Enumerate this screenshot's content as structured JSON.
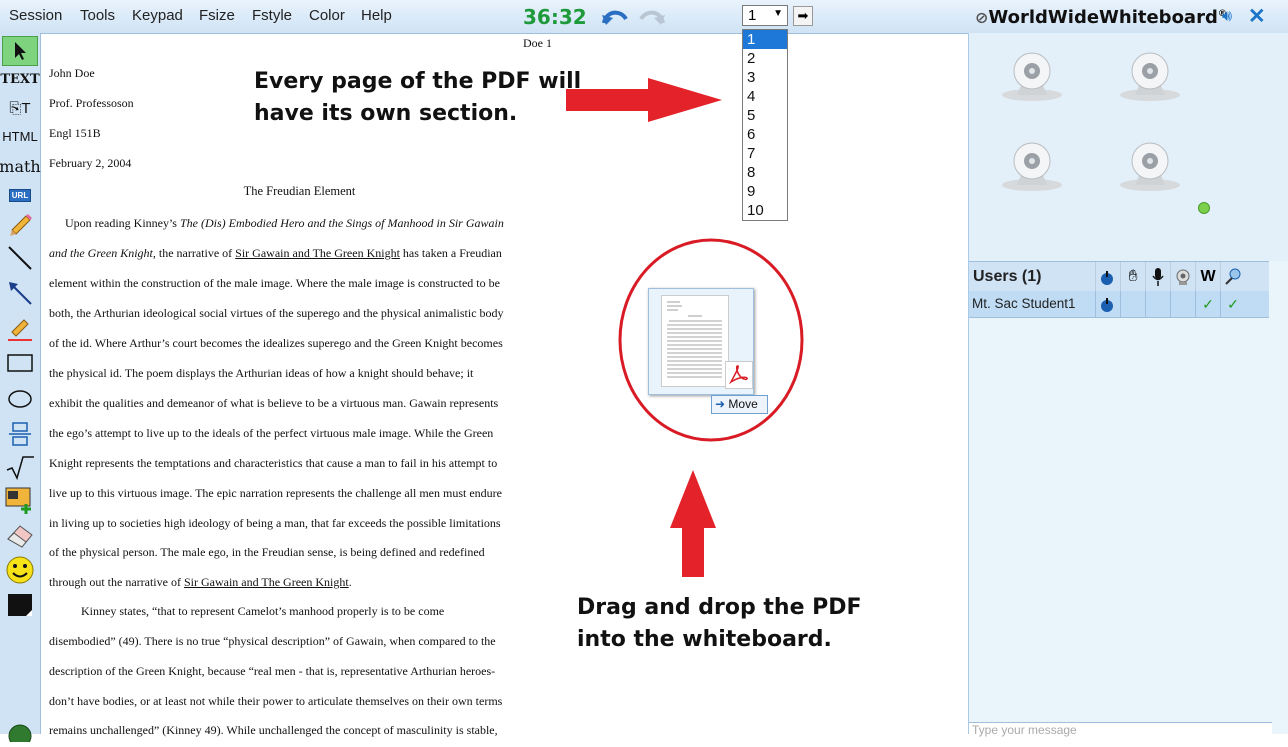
{
  "menubar": {
    "items": [
      "Session",
      "Tools",
      "Keypad",
      "Fsize",
      "Fstyle",
      "Color",
      "Help"
    ],
    "timer": "36:32",
    "page_select_value": "1",
    "brand": "WorldWideWhiteboard",
    "brand_mark": "®"
  },
  "page_list": [
    "1",
    "2",
    "3",
    "4",
    "5",
    "6",
    "7",
    "8",
    "9",
    "10"
  ],
  "toolbar": {
    "text_label": "TEXT",
    "html_label": "HTML",
    "math_label": "math",
    "url_label": "URL"
  },
  "document": {
    "header_right": "Doe 1",
    "lines": [
      "John Doe",
      "Prof. Professoson",
      "Engl 151B",
      "February 2, 2004"
    ],
    "title": "The Freudian Element",
    "p1_l1_a": "Upon reading Kinney’s ",
    "p1_l1_b": "The (Dis) Embodied Hero and the Sings of Manhood in Sir Gawain",
    "p1_l2_a": "and the Green Knight",
    "p1_l2_b": ", the narrative of ",
    "p1_l2_c": "Sir Gawain and The Green Knight",
    "p1_l2_d": " has taken a Freudian",
    "body": [
      "element within the construction of the male image.  Where the male image is constructed to be",
      "both, the Arthurian ideological social virtues of the superego and the physical animalistic body",
      "of the id.  Where Arthur’s court becomes the idealizes superego and the Green Knight becomes",
      "the physical id.  The poem displays the Arthurian ideas of how a knight should behave; it",
      "exhibit the qualities and demeanor of what is believe to be a virtuous man.  Gawain represents",
      "the ego’s attempt to live up to the ideals of the perfect virtuous male image.  While the Green",
      "Knight represents the temptations and characteristics that cause a man to fail in his attempt to",
      "live up to this virtuous image.  The epic narration represents the challenge all men must endure",
      "in living up to societies high ideology of being a man, that far exceeds the possible limitations",
      "of the physical person.  The male ego, in the Freudian sense, is being defined and redefined"
    ],
    "p1_last_a": "through out the narrative of ",
    "p1_last_b": "Sir Gawain and The Green Knight",
    "p1_last_c": ".",
    "p2": [
      "Kinney states, “that to represent Camelot’s manhood properly is to be come",
      "disembodied” (49).   There is no true “physical description” of Gawain, when compared to the",
      "description of the Green Knight, because “real men - that is, representative Arthurian heroes-",
      "don’t have bodies, or at least not while their power to articulate themselves on their own terms",
      "remains unchallenged” (Kinney 49).  While unchallenged the concept of masculinity is stable,"
    ]
  },
  "annotations": {
    "top_line1": "Every page of the PDF will",
    "top_line2": "have its own section.",
    "bottom_line1": "Drag and drop the PDF",
    "bottom_line2": "into the whiteboard.",
    "move_label": "Move",
    "arrow_color": "#e3222a"
  },
  "users": {
    "title": "Users (1)",
    "w_label": "W",
    "user_name": "Mt. Sac Student1",
    "check": "✓",
    "message_placeholder": "Type your message"
  }
}
